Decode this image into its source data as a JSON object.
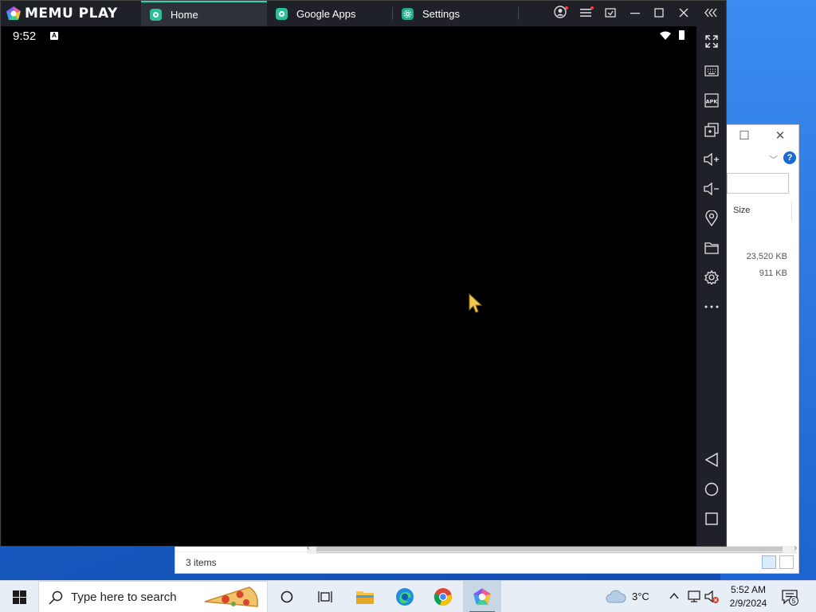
{
  "memu": {
    "brand": "MEMU PLAY",
    "tabs": [
      {
        "label": "Home"
      },
      {
        "label": "Google Apps"
      },
      {
        "label": "Settings"
      }
    ],
    "status_time": "9:52",
    "status_badge": "A"
  },
  "explorer": {
    "column_size": "Size",
    "sizes": [
      "23,520 KB",
      "911 KB"
    ],
    "status": "3 items"
  },
  "taskbar": {
    "search_placeholder": "Type here to search",
    "weather": "3°C",
    "time": "5:52 AM",
    "date": "2/9/2024",
    "notification_count": "5"
  },
  "colors": {
    "accent": "#2ed4b0",
    "memu_bar": "#1e2127",
    "desktop": "#1c5fc4"
  }
}
